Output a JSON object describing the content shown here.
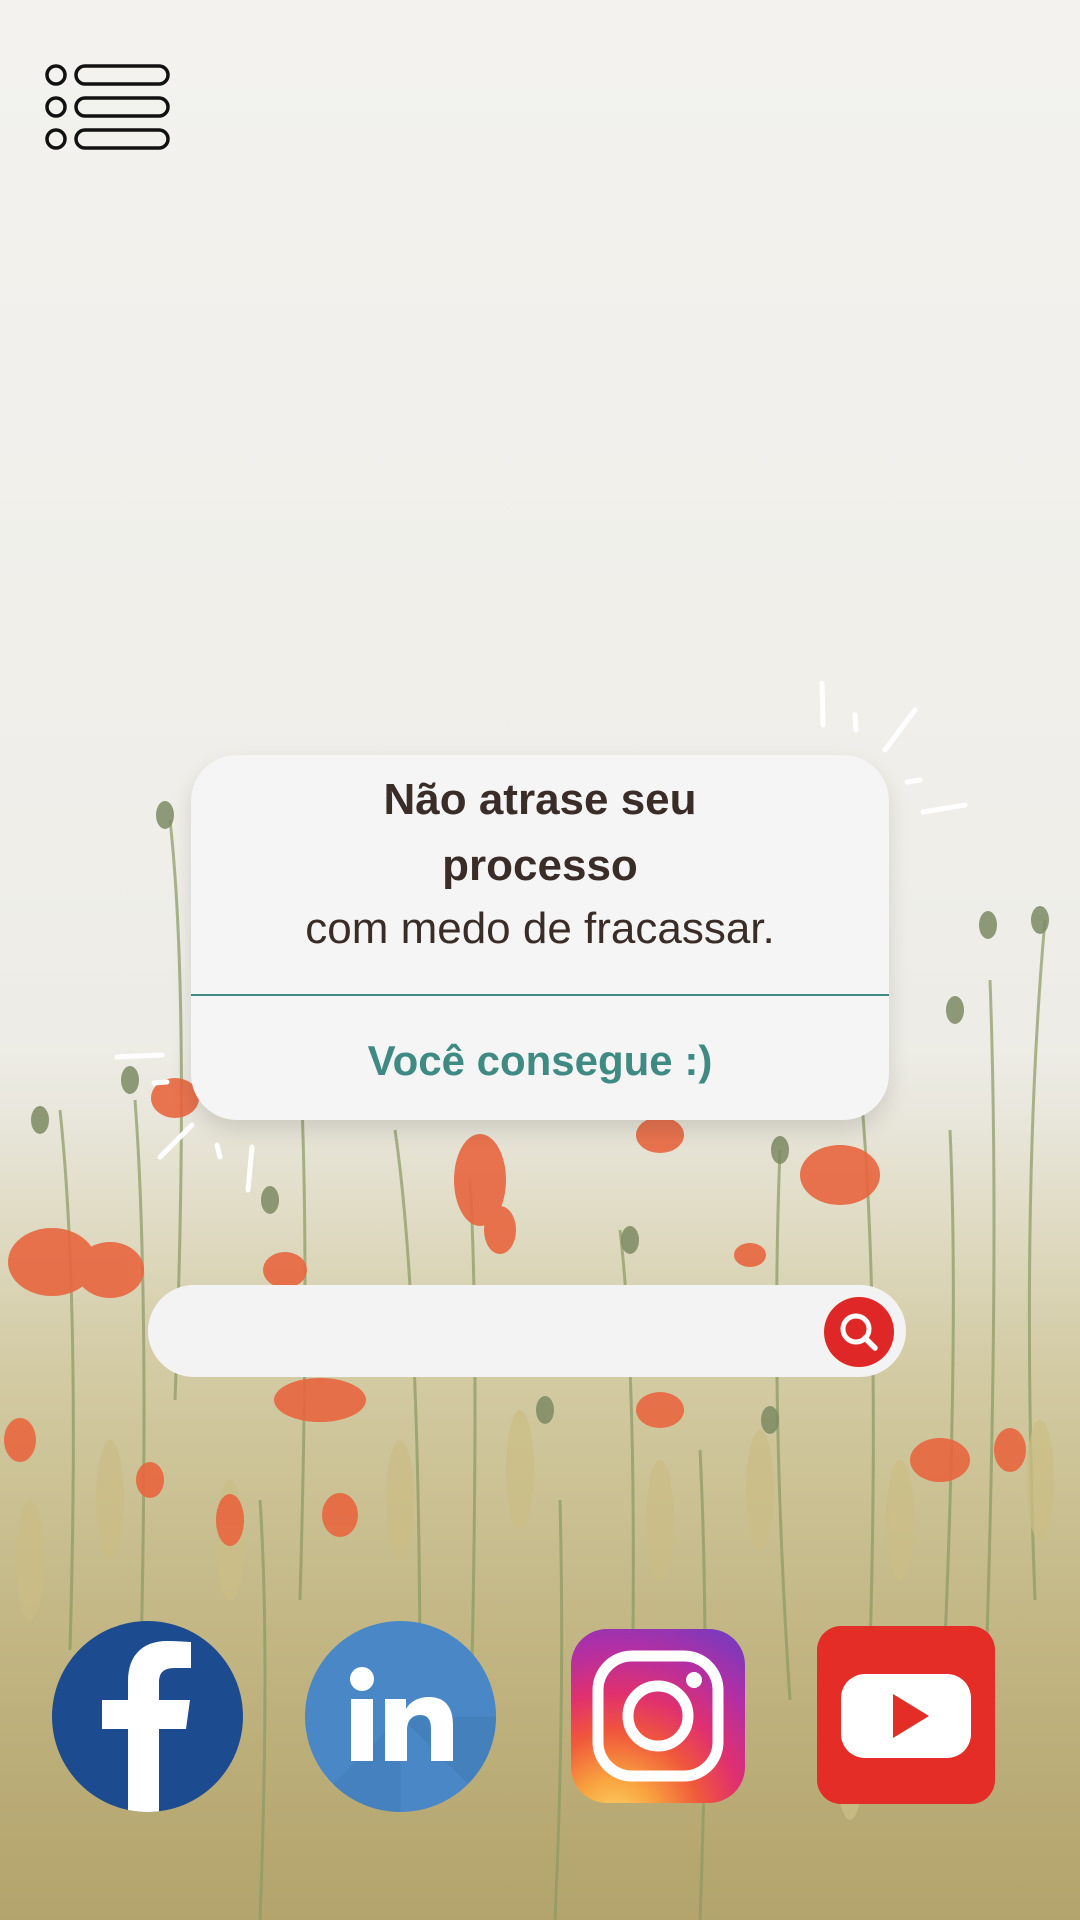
{
  "menu": {
    "icon": "list-menu-icon"
  },
  "card": {
    "title_line1": "Não atrase seu",
    "title_line2": "processo",
    "subtitle": "com medo de fracassar.",
    "cta": "Você consegue :)",
    "cta_color": "#3f8a82",
    "text_color": "#3a2d28"
  },
  "search": {
    "placeholder": "",
    "value": "",
    "button_icon": "search-icon",
    "button_color": "#e02727"
  },
  "social": [
    {
      "name": "facebook",
      "icon": "facebook-icon",
      "color": "#1d4b8f"
    },
    {
      "name": "linkedin",
      "icon": "linkedin-icon",
      "color": "#4a87c6"
    },
    {
      "name": "instagram",
      "icon": "instagram-icon",
      "color": "#e0306f"
    },
    {
      "name": "youtube",
      "icon": "youtube-icon",
      "color": "#e32d26"
    }
  ],
  "background": {
    "description_icon": "poppy-field-image"
  }
}
